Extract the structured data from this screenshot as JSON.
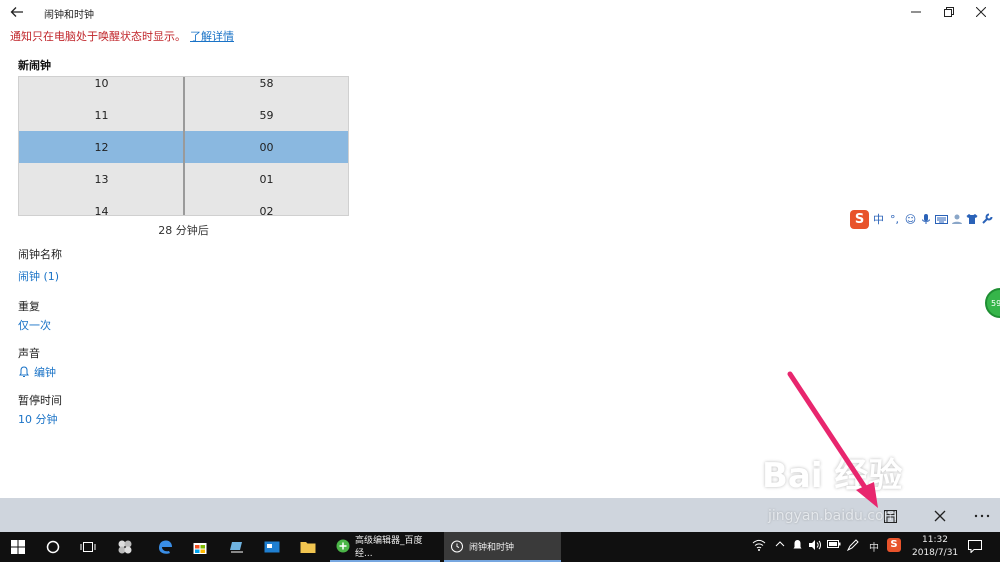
{
  "window": {
    "title": "闹钟和时钟"
  },
  "notice": {
    "text": "通知只在电脑处于唤醒状态时显示。",
    "link": "了解详情"
  },
  "alarm": {
    "section_title": "新闹钟",
    "hours": [
      "10",
      "11",
      "12",
      "13",
      "14"
    ],
    "minutes": [
      "58",
      "59",
      "00",
      "01",
      "02"
    ],
    "selected_hour": "12",
    "selected_minute": "00",
    "countdown": "28 分钟后"
  },
  "fields": {
    "name_label": "闹钟名称",
    "name_value": "闹钟 (1)",
    "repeat_label": "重复",
    "repeat_value": "仅一次",
    "sound_label": "声音",
    "sound_value": "编钟",
    "snooze_label": "暂停时间",
    "snooze_value": "10 分钟"
  },
  "ime": {
    "logo": "S",
    "mode": "中",
    "punct": "°,"
  },
  "float_badge": "59",
  "taskbar": {
    "apps": [
      {
        "label": "高级编辑器_百度经..."
      },
      {
        "label": "闹钟和时钟"
      }
    ],
    "tray_ime": "中",
    "time": "11:32",
    "date": "2018/7/31"
  },
  "watermark": {
    "brand": "Bai 经验",
    "url": "jingyan.baidu.com"
  },
  "colors": {
    "accent": "#1a73c7",
    "selection": "#8ab8e0",
    "notice": "#c0262b",
    "arrow": "#e8266e"
  }
}
